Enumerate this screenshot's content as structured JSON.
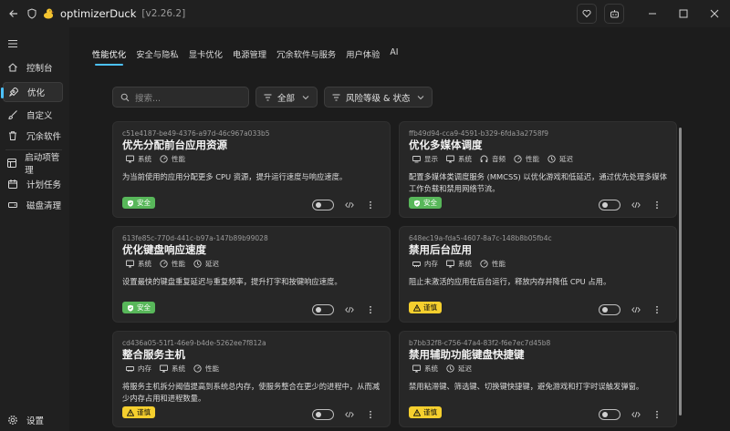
{
  "titlebar": {
    "app_name": "optimizerDuck",
    "version": "[v2.26.2]"
  },
  "sidebar": {
    "items": [
      {
        "label": "控制台",
        "icon": "home-icon"
      },
      {
        "label": "优化",
        "icon": "rocket-icon",
        "active": true
      },
      {
        "label": "自定义",
        "icon": "brush-icon"
      },
      {
        "label": "冗余软件",
        "icon": "trash-icon"
      },
      {
        "label": "启动项管理",
        "icon": "startup-icon"
      },
      {
        "label": "计划任务",
        "icon": "calendar-icon"
      },
      {
        "label": "磁盘清理",
        "icon": "disk-icon"
      }
    ],
    "settings_label": "设置"
  },
  "tabs": [
    {
      "label": "性能优化",
      "active": true
    },
    {
      "label": "安全与隐私"
    },
    {
      "label": "显卡优化"
    },
    {
      "label": "电源管理"
    },
    {
      "label": "冗余软件与服务"
    },
    {
      "label": "用户体验"
    },
    {
      "label": "AI"
    }
  ],
  "filters": {
    "search_placeholder": "搜索...",
    "category": "全部",
    "risk_status": "风险等级 & 状态"
  },
  "cards": [
    {
      "uuid": "c51e4187-be49-4376-a97d-46c967a033b5",
      "title": "优先分配前台应用资源",
      "tags": [
        {
          "label": "系统",
          "icon": "monitor-icon"
        },
        {
          "label": "性能",
          "icon": "gauge-icon"
        }
      ],
      "description": "为当前使用的应用分配更多 CPU 资源，提升运行速度与响应速度。",
      "badge": "安全",
      "badge_type": "safe"
    },
    {
      "uuid": "ffb49d94-cca9-4591-b329-6fda3a2758f9",
      "title": "优化多媒体调度",
      "tags": [
        {
          "label": "显示",
          "icon": "display-icon"
        },
        {
          "label": "系统",
          "icon": "monitor-icon"
        },
        {
          "label": "音频",
          "icon": "headphones-icon"
        },
        {
          "label": "性能",
          "icon": "gauge-icon"
        },
        {
          "label": "延迟",
          "icon": "clock-icon"
        }
      ],
      "description": "配置多媒体类调度服务 (MMCSS) 以优化游戏和低延迟，通过优先处理多媒体工作负载和禁用网络节流。",
      "badge": "安全",
      "badge_type": "safe"
    },
    {
      "uuid": "613fe85c-770d-441c-b97a-147b89b99028",
      "title": "优化键盘响应速度",
      "tags": [
        {
          "label": "系统",
          "icon": "monitor-icon"
        },
        {
          "label": "性能",
          "icon": "gauge-icon"
        },
        {
          "label": "延迟",
          "icon": "clock-icon"
        }
      ],
      "description": "设置最快的键盘重复延迟与重复频率，提升打字和按键响应速度。",
      "badge": "安全",
      "badge_type": "safe"
    },
    {
      "uuid": "648ec19a-fda5-4607-8a7c-148b8b05fb4c",
      "title": "禁用后台应用",
      "tags": [
        {
          "label": "内存",
          "icon": "memory-icon"
        },
        {
          "label": "系统",
          "icon": "monitor-icon"
        },
        {
          "label": "性能",
          "icon": "gauge-icon"
        }
      ],
      "description": "阻止未激活的应用在后台运行，释放内存并降低 CPU 占用。",
      "badge": "谨慎",
      "badge_type": "caution"
    },
    {
      "uuid": "cd436a05-51f1-46e9-b4de-5262ee7f812a",
      "title": "整合服务主机",
      "tags": [
        {
          "label": "内存",
          "icon": "memory-icon"
        },
        {
          "label": "系统",
          "icon": "monitor-icon"
        },
        {
          "label": "性能",
          "icon": "gauge-icon"
        }
      ],
      "description": "将服务主机拆分阈值提高到系统总内存，使服务整合在更少的进程中，从而减少内存占用和进程数量。",
      "badge": "谨慎",
      "badge_type": "caution"
    },
    {
      "uuid": "b7bb32f8-c756-47a4-83f2-f6e7ec7d45b8",
      "title": "禁用辅助功能键盘快捷键",
      "tags": [
        {
          "label": "系统",
          "icon": "monitor-icon"
        },
        {
          "label": "延迟",
          "icon": "clock-icon"
        }
      ],
      "description": "禁用粘滞键、筛选键、切换键快捷键，避免游戏和打字时误触发弹窗。",
      "badge": "谨慎",
      "badge_type": "caution"
    }
  ],
  "colors": {
    "accent": "#4cc2ff",
    "safe": "#58b75a",
    "caution": "#f5cf2e",
    "background": "#1c1c1c",
    "card": "#272727"
  }
}
